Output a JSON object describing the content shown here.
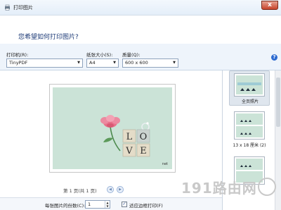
{
  "window": {
    "title": "打印图片",
    "close": "x"
  },
  "heading": "您希望如何打印图片?",
  "options": {
    "printer_label": "打印机(R):",
    "printer_value": "TinyPDF",
    "paper_label": "纸张大小(S):",
    "paper_value": "A4",
    "quality_label": "质量(Q):",
    "quality_value": "600 x 600",
    "help": "?"
  },
  "preview": {
    "tile_letters": [
      "L",
      "O",
      "V",
      "E"
    ],
    "caption": "net",
    "pager": "第 1 页(共 1 页)",
    "prev": "◀",
    "next": "▶"
  },
  "bottom": {
    "copies_label": "每张图片的份数(C):",
    "copies_value": "1",
    "fit_label": "适应边框打印(F)",
    "fit_checked": "✓"
  },
  "layouts": [
    {
      "caption": "全页照片"
    },
    {
      "caption": "13 x 18 厘米 (2)"
    },
    {
      "caption": ""
    }
  ],
  "watermark": "191路由网",
  "colors": {
    "accent": "#2e6bd0",
    "photo_bg": "#cbe3d7",
    "heading": "#1f3c78"
  }
}
